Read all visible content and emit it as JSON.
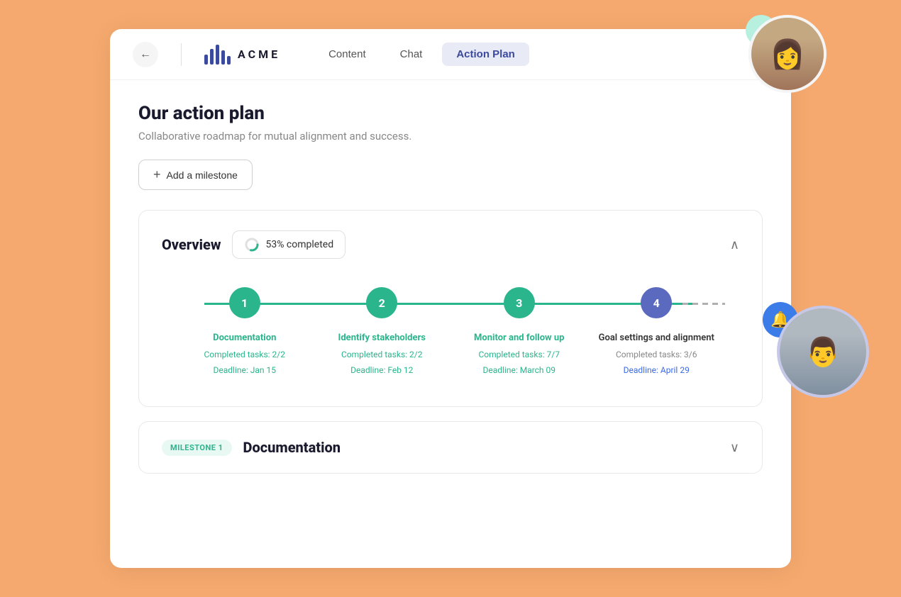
{
  "nav": {
    "back_label": "←",
    "logo_text": "ACME",
    "links": [
      {
        "id": "content",
        "label": "Content",
        "active": false
      },
      {
        "id": "chat",
        "label": "Chat",
        "active": false
      },
      {
        "id": "action-plan",
        "label": "Action Plan",
        "active": true
      }
    ]
  },
  "page": {
    "title": "Our action plan",
    "subtitle": "Collaborative roadmap for mutual alignment and success.",
    "add_milestone_label": "Add a milestone"
  },
  "overview": {
    "title": "Overview",
    "progress_label": "53% completed",
    "progress_value": 53
  },
  "milestones": [
    {
      "number": "1",
      "label": "Documentation",
      "tasks": "Completed tasks: 2/2",
      "deadline": "Deadline: Jan 15",
      "completed": true
    },
    {
      "number": "2",
      "label": "Identify stakeholders",
      "tasks": "Completed tasks: 2/2",
      "deadline": "Deadline: Feb 12",
      "completed": true
    },
    {
      "number": "3",
      "label": "Monitor and follow up",
      "tasks": "Completed tasks: 7/7",
      "deadline": "Deadline: March 09",
      "completed": true
    },
    {
      "number": "4",
      "label": "Goal settings and alignment",
      "tasks": "Completed tasks: 3/6",
      "deadline": "Deadline: April 29",
      "completed": false
    }
  ],
  "milestone_section": {
    "badge": "MILESTONE 1",
    "title": "Documentation"
  },
  "colors": {
    "green": "#2ab58c",
    "blue": "#3b6ae8",
    "purple": "#5b6abf",
    "accent_bg": "#e8eaf6"
  }
}
